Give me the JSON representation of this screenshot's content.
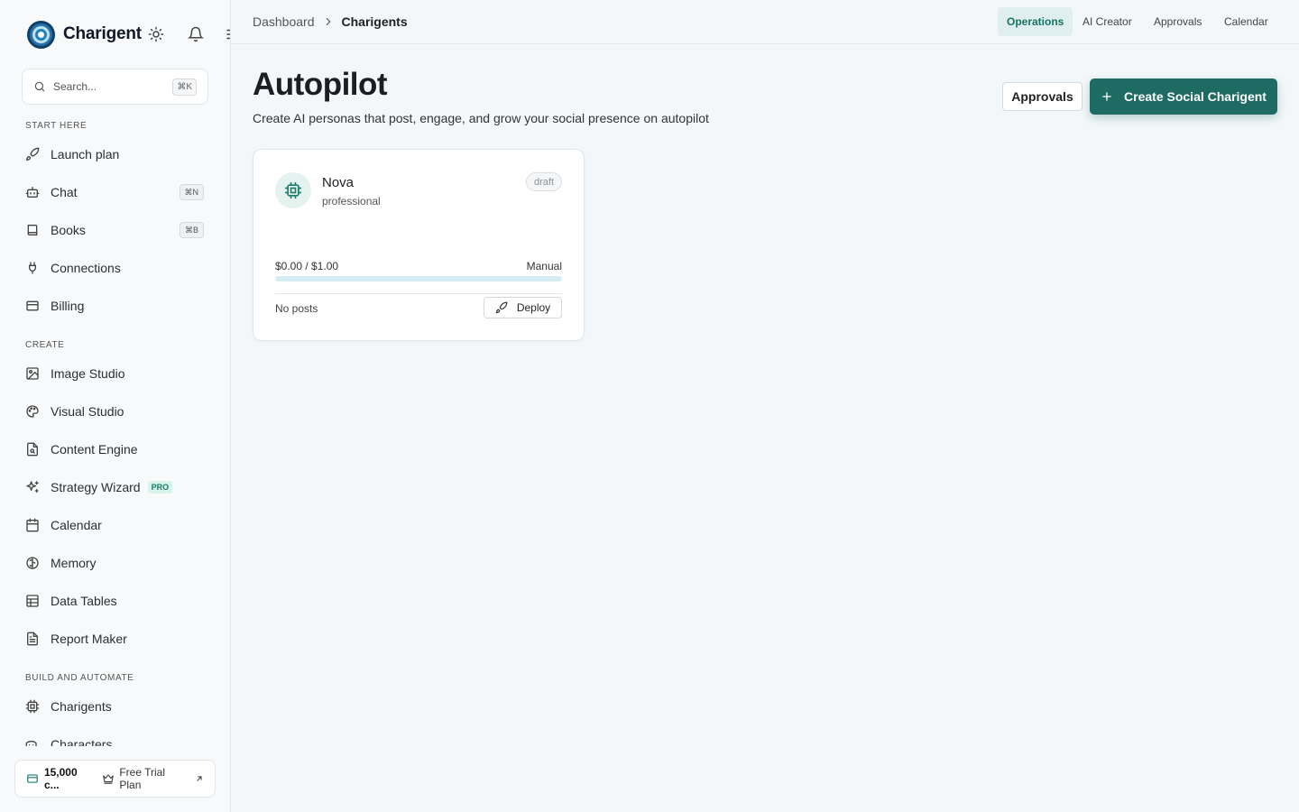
{
  "brand": {
    "name": "Charigent"
  },
  "search": {
    "placeholder": "Search...",
    "shortcut": "⌘K"
  },
  "sidebar": {
    "sections": [
      {
        "label": "START HERE"
      },
      {
        "label": "CREATE"
      },
      {
        "label": "BUILD AND AUTOMATE"
      }
    ],
    "items": [
      {
        "label": "Launch plan",
        "icon": "rocket-icon"
      },
      {
        "label": "Chat",
        "icon": "bot-icon",
        "shortcut": "⌘N"
      },
      {
        "label": "Books",
        "icon": "book-icon",
        "shortcut": "⌘B"
      },
      {
        "label": "Connections",
        "icon": "plug-icon"
      },
      {
        "label": "Billing",
        "icon": "credit-card-icon"
      },
      {
        "label": "Image Studio",
        "icon": "image-icon"
      },
      {
        "label": "Visual Studio",
        "icon": "palette-icon"
      },
      {
        "label": "Content Engine",
        "icon": "file-search-icon"
      },
      {
        "label": "Strategy Wizard",
        "icon": "sparkles-icon",
        "badge": "PRO"
      },
      {
        "label": "Calendar",
        "icon": "calendar-icon"
      },
      {
        "label": "Memory",
        "icon": "brain-icon"
      },
      {
        "label": "Data Tables",
        "icon": "table-icon"
      },
      {
        "label": "Report Maker",
        "icon": "file-text-icon"
      },
      {
        "label": "Charigents",
        "icon": "cpu-icon"
      },
      {
        "label": "Characters",
        "icon": "drama-icon"
      }
    ]
  },
  "plan": {
    "credits": "15,000 c...",
    "name": "Free Trial Plan"
  },
  "breadcrumb": {
    "parent": "Dashboard",
    "current": "Charigents"
  },
  "topnav": {
    "items": [
      {
        "label": "Operations",
        "active": true
      },
      {
        "label": "AI Creator"
      },
      {
        "label": "Approvals"
      },
      {
        "label": "Calendar"
      }
    ]
  },
  "page": {
    "title": "Autopilot",
    "subtitle": "Create AI personas that post, engage, and grow your social presence on autopilot",
    "approvals_button": "Approvals",
    "create_button": "Create Social Charigent"
  },
  "agent_card": {
    "name": "Nova",
    "style": "professional",
    "status": "draft",
    "budget": "$0.00 / $1.00",
    "budget_used_fraction": 0,
    "mode": "Manual",
    "posts": "No posts",
    "deploy_label": "Deploy"
  },
  "colors": {
    "accent": "#1e6b64",
    "active_tab_bg": "#dfeeee",
    "pro_badge": "#d7f3ea"
  }
}
